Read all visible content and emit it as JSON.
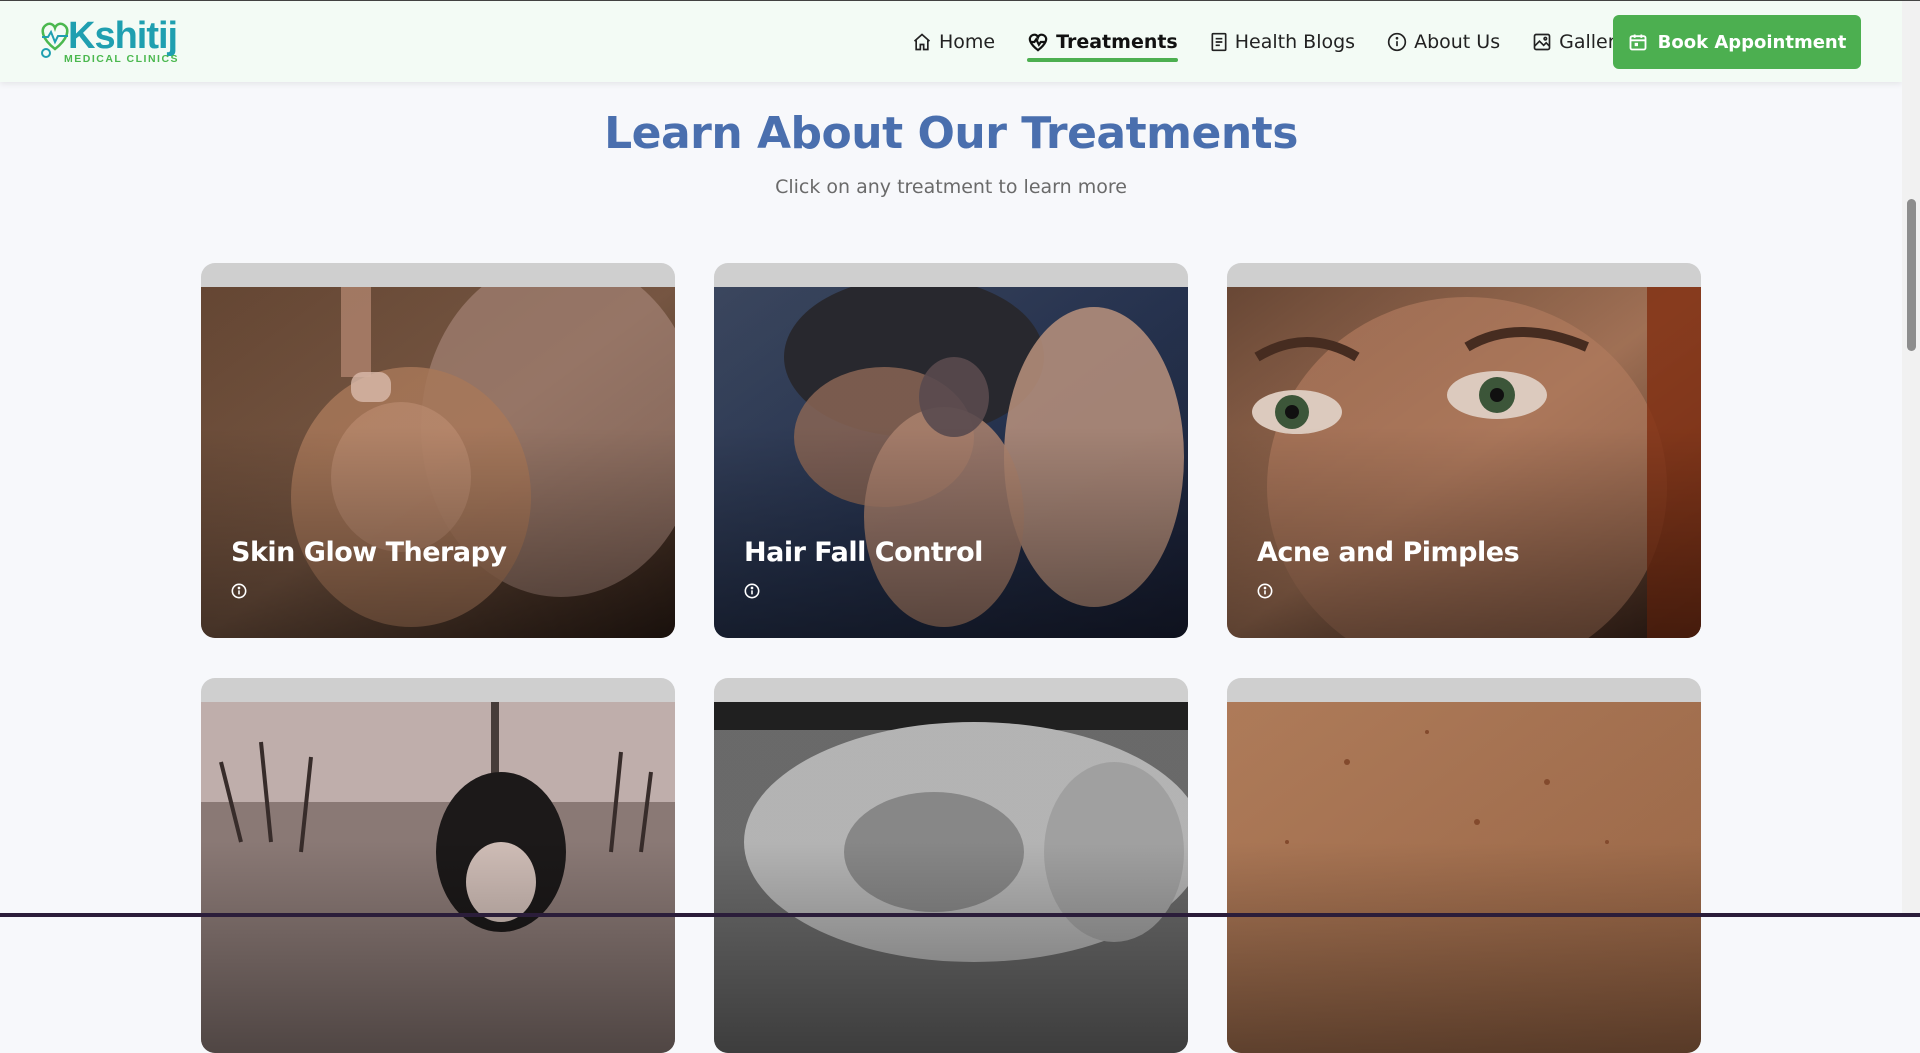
{
  "brand": {
    "name": "Kshitij",
    "tagline": "MEDICAL CLINICS"
  },
  "nav": {
    "items": [
      {
        "label": "Home",
        "icon": "home-icon"
      },
      {
        "label": "Treatments",
        "icon": "heart-pulse-icon",
        "active": true
      },
      {
        "label": "Health Blogs",
        "icon": "document-icon"
      },
      {
        "label": "About Us",
        "icon": "info-icon"
      },
      {
        "label": "Gallery",
        "icon": "gallery-icon"
      }
    ],
    "cta_label": "Book Appointment",
    "cta_icon": "calendar-icon"
  },
  "section": {
    "title": "Learn About Our Treatments",
    "subtitle": "Click on any treatment to learn more"
  },
  "treatments": [
    {
      "title": "Skin Glow Therapy",
      "icon": "info-icon"
    },
    {
      "title": "Hair Fall Control",
      "icon": "info-icon"
    },
    {
      "title": "Acne and Pimples",
      "icon": "info-icon"
    },
    {
      "title": "",
      "icon": ""
    },
    {
      "title": "",
      "icon": ""
    },
    {
      "title": "",
      "icon": ""
    }
  ],
  "colors": {
    "accent_green": "#4caf50",
    "title_blue": "#4a6fae",
    "logo_teal": "#1f9fb0",
    "navbar_bg": "#f3fbf5",
    "page_bg": "#f7f8fb"
  }
}
